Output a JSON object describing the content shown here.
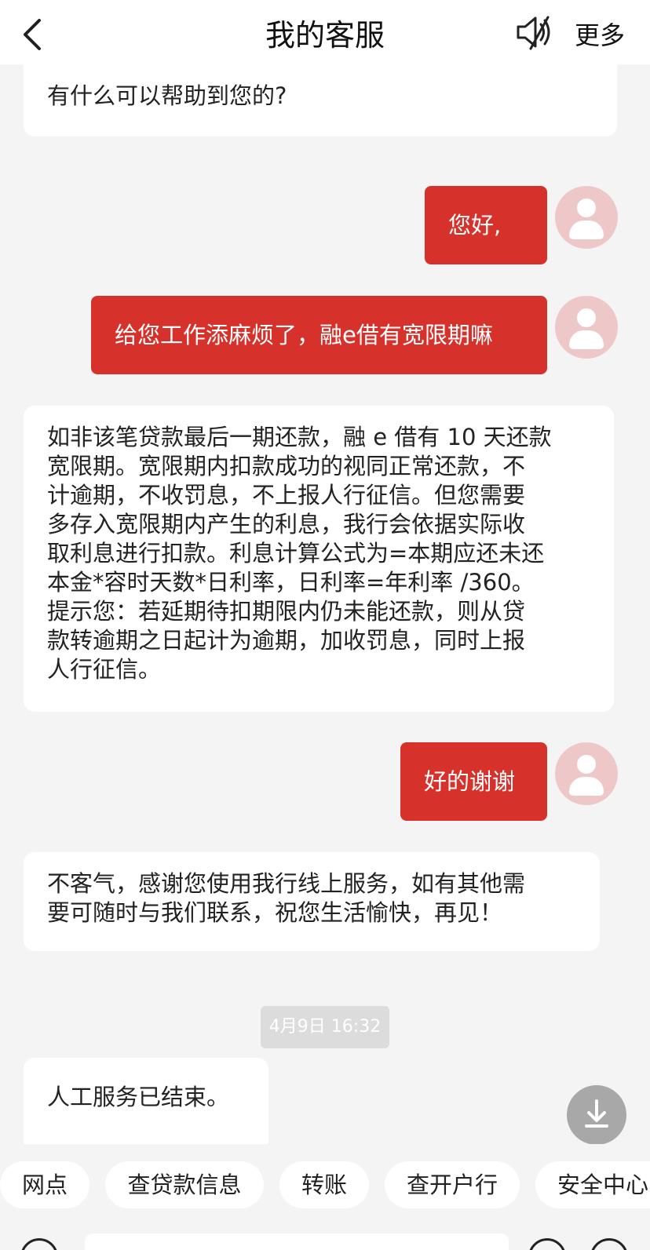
{
  "header": {
    "title": "我的客服",
    "more_label": "更多",
    "back_icon": "chevron-left-icon",
    "sound_icon": "speaker-muted-icon"
  },
  "messages": [
    {
      "side": "agent",
      "text": "有什么可以帮助到您的?"
    },
    {
      "side": "user",
      "text": "您好,"
    },
    {
      "side": "user",
      "text": "给您工作添麻烦了，融e借有宽限期嘛"
    },
    {
      "side": "agent",
      "lines": [
        "如非该笔贷款最后一期还款，融 e 借有 10 天还款",
        "宽限期。宽限期内扣款成功的视同正常还款，不",
        "计逾期，不收罚息，不上报人行征信。但您需要",
        "多存入宽限期内产生的利息，我行会依据实际收",
        "取利息进行扣款。利息计算公式为=本期应还未还",
        "本金*容时天数*日利率，日利率=年利率 /360。",
        "提示您：若延期待扣期限内仍未能还款，则从贷",
        "款转逾期之日起计为逾期，加收罚息，同时上报",
        "人行征信。"
      ]
    },
    {
      "side": "user",
      "text": "好的谢谢"
    },
    {
      "side": "agent",
      "lines": [
        "不客气，感谢您使用我行线上服务，如有其他需",
        "要可随时与我们联系，祝您生活愉快，再见！"
      ]
    },
    {
      "side": "agent",
      "text": "人工服务已结束。"
    }
  ],
  "timestamp": "4月9日 16:32",
  "quick_actions": [
    "网点",
    "查贷款信息",
    "转账",
    "查开户行",
    "安全中心"
  ],
  "colors": {
    "accent": "#d6322b",
    "avatar_bg": "#eec8c8",
    "background": "#f4f4f4"
  }
}
